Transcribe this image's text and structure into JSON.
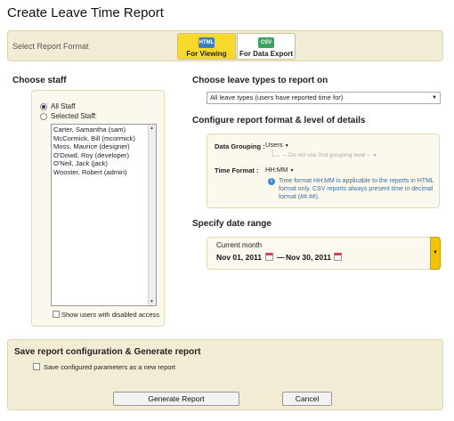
{
  "page": {
    "title": "Create Leave Time Report"
  },
  "report_format": {
    "label": "Select Report Format",
    "options": [
      {
        "icon_text": "HTML",
        "label": "For Viewing",
        "selected": true
      },
      {
        "icon_text": "CSV",
        "label": "For Data Export",
        "selected": false
      }
    ]
  },
  "staff": {
    "heading": "Choose staff",
    "all_staff_label": "All Staff",
    "selected_staff_label": "Selected Staff:",
    "selected_option": "All Staff",
    "list": [
      "Carter, Samantha (sam)",
      "McCormick, Bill (mcormick)",
      "Moss, Maurice (designer)",
      "O'Dowd, Roy (developer)",
      "O'Neil, Jack (jack)",
      "Wooster, Robert (admin)"
    ],
    "show_disabled_label": "Show users with disabled access"
  },
  "leave_types": {
    "heading": "Choose leave types to report on",
    "selected": "All leave types (users have reported time for)"
  },
  "config": {
    "heading": "Configure report format & level of details",
    "data_grouping_label": "Data Grouping :",
    "data_grouping_value": "Users",
    "second_grouping": "-- Do not use 2nd grouping level --",
    "time_format_label": "Time Format :",
    "time_format_value": "HH:MM",
    "info_text": "Time format HH:MM is applicable to the reports in HTML format only. CSV reports always present time in decimal format (##.##)."
  },
  "date_range": {
    "heading": "Specify date range",
    "preset": "Current month",
    "from": "Nov 01, 2011",
    "separator": "—",
    "to": "Nov 30, 2011"
  },
  "save": {
    "heading": "Save report configuration & Generate report",
    "save_params_label": "Save configured parameters as a new report",
    "generate_label": "Generate Report",
    "cancel_label": "Cancel"
  },
  "colors": {
    "accent_yellow": "#f7d92c",
    "panel_bg": "#f3ecd5",
    "info_blue": "#3a6ea5"
  }
}
